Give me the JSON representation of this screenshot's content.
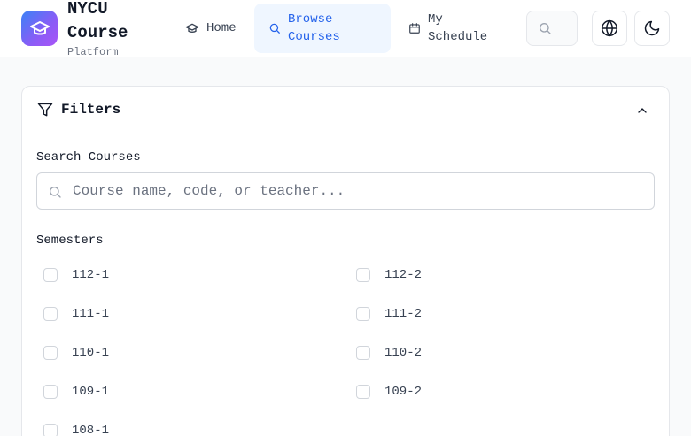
{
  "brand": {
    "name": "NYCU Course",
    "subtitle": "Platform"
  },
  "nav": {
    "home": "Home",
    "browse": "Browse Courses",
    "schedule": "My Schedule"
  },
  "filters": {
    "title": "Filters",
    "search_label": "Search Courses",
    "search_placeholder": "Course name, code, or teacher...",
    "search_value": "",
    "semesters_label": "Semesters",
    "semesters": [
      {
        "label": "112-1",
        "checked": false
      },
      {
        "label": "112-2",
        "checked": false
      },
      {
        "label": "111-1",
        "checked": false
      },
      {
        "label": "111-2",
        "checked": false
      },
      {
        "label": "110-1",
        "checked": false
      },
      {
        "label": "110-2",
        "checked": false
      },
      {
        "label": "109-1",
        "checked": false
      },
      {
        "label": "109-2",
        "checked": false
      },
      {
        "label": "108-1",
        "checked": false
      }
    ]
  },
  "icons": {
    "logo": "graduation-cap-icon",
    "home": "graduation-cap-icon",
    "browse": "search-icon",
    "schedule": "calendar-icon",
    "language": "globe-icon",
    "theme": "moon-icon",
    "filter": "funnel-icon",
    "collapse": "chevron-up-icon"
  },
  "colors": {
    "accent": "#2563eb",
    "active_nav_bg": "#eff6ff"
  }
}
